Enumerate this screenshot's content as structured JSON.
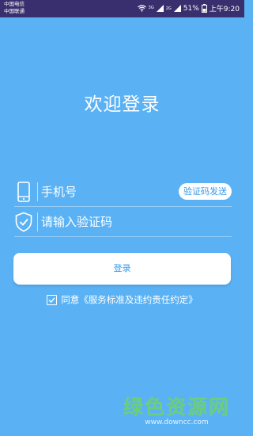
{
  "status_bar": {
    "carrier_1": "中国电信",
    "carrier_2": "中国联通",
    "network_1": "3G",
    "network_2": "2G",
    "battery_percent": "51%",
    "time": "上午9:20"
  },
  "title": "欢迎登录",
  "phone_field": {
    "placeholder": "手机号",
    "icon": "phone-icon"
  },
  "send_code_button": "验证码发送",
  "code_field": {
    "placeholder": "请输入验证码",
    "icon": "shield-check-icon"
  },
  "login_button": "登录",
  "agreement": {
    "checked": true,
    "text": "同意《服务标准及违约责任约定》"
  },
  "watermark": {
    "text": "绿色资源网",
    "url": "www.downcc.com"
  },
  "colors": {
    "background": "#5ab2f5",
    "status_bar": "#3a2f6e",
    "accent": "#3a9be8",
    "watermark": "#6fd26f"
  }
}
